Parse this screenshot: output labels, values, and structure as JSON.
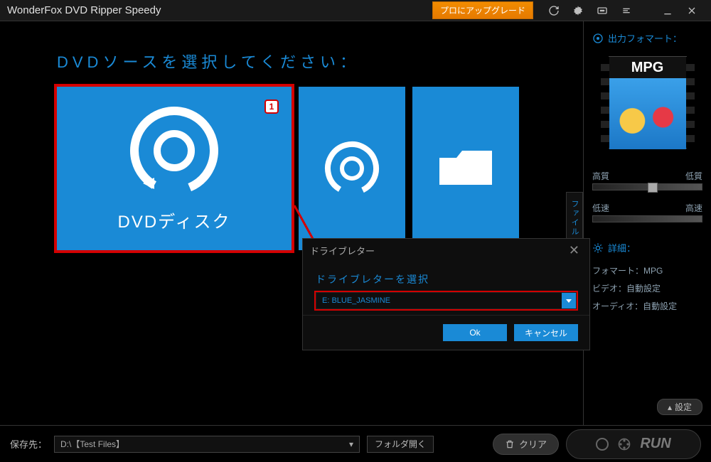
{
  "titlebar": {
    "title": "WonderFox DVD Ripper Speedy",
    "upgrade": "プロにアップグレード"
  },
  "main": {
    "heading": "DVDソースを選択してください：",
    "card_dvd_label": "DVDディスク",
    "badge": "1"
  },
  "dialog": {
    "title": "ドライブレター",
    "sublabel": "ドライブレターを選択",
    "selected": "E: BLUE_JASMINE",
    "ok": "Ok",
    "cancel": "キャンセル"
  },
  "sidebar": {
    "format_title": "出力フォマート：",
    "format_badge": "MPG",
    "slider_quality": {
      "high": "高質",
      "low": "低質"
    },
    "slider_speed": {
      "slow": "低速",
      "fast": "高速"
    },
    "details_title": "詳細：",
    "detail_format": "フォマート：MPG",
    "detail_video": "ビデオ：自動設定",
    "detail_audio": "オーディオ：自動設定",
    "settings_btn": "設定",
    "vtab": "ファイル"
  },
  "footer": {
    "save_label": "保存先：",
    "path": "D:\\【Test Files】",
    "folder_open": "フォルダ開く",
    "clear": "クリア",
    "run": "RUN"
  }
}
